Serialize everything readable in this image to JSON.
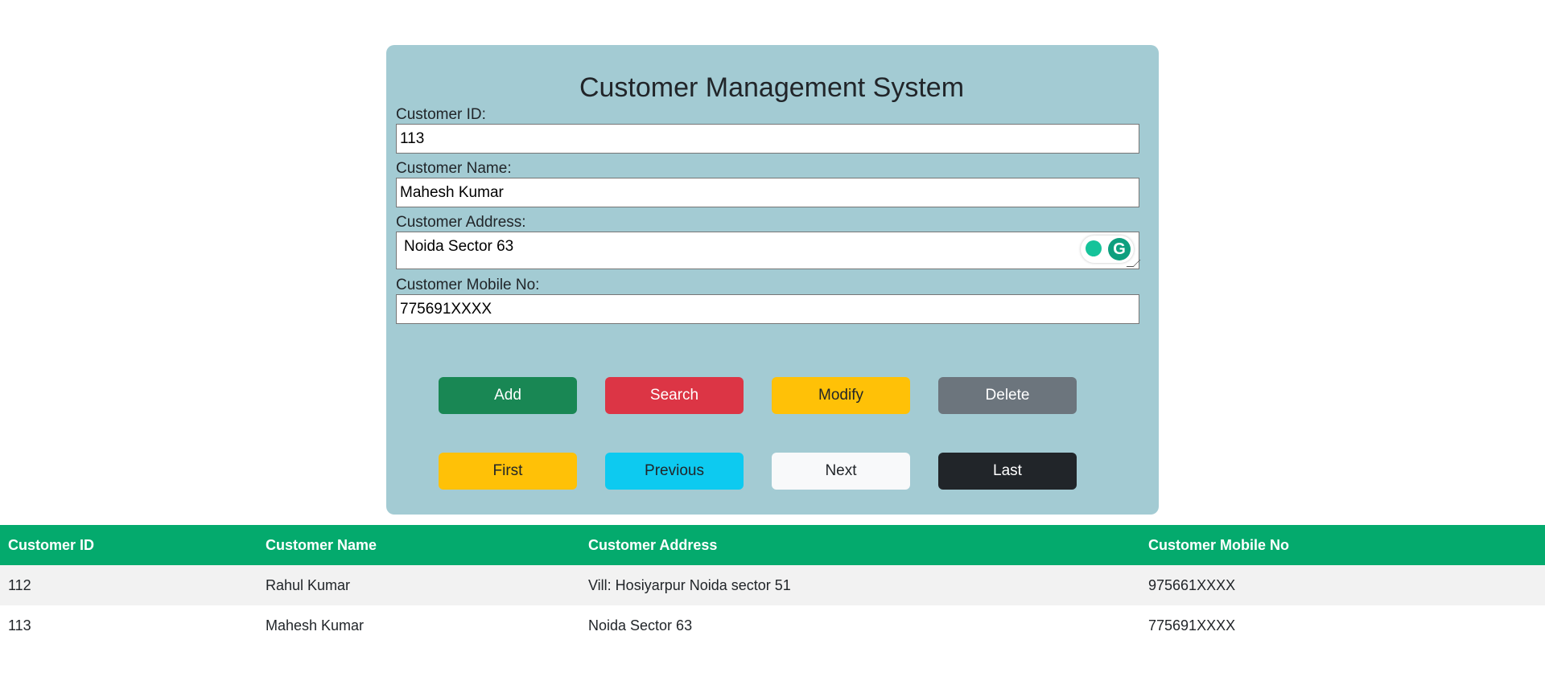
{
  "app": {
    "title": "Customer Management System"
  },
  "form": {
    "id_label": "Customer ID:",
    "id_value": "113",
    "name_label": "Customer Name:",
    "name_value": "Mahesh Kumar",
    "address_label": "Customer Address:",
    "address_value": "Noida Sector 63",
    "mobile_label": "Customer Mobile No:",
    "mobile_value": "775691XXXX"
  },
  "actions": {
    "add": {
      "label": "Add",
      "bg": "#198754",
      "fg": "#ffffff"
    },
    "search": {
      "label": "Search",
      "bg": "#dc3545",
      "fg": "#ffffff"
    },
    "modify": {
      "label": "Modify",
      "bg": "#ffc107",
      "fg": "#212529"
    },
    "delete": {
      "label": "Delete",
      "bg": "#6c757d",
      "fg": "#ffffff"
    }
  },
  "navigation": {
    "first": {
      "label": "First",
      "bg": "#ffc107",
      "fg": "#212529"
    },
    "previous": {
      "label": "Previous",
      "bg": "#0dcaf0",
      "fg": "#212529"
    },
    "next": {
      "label": "Next",
      "bg": "#f8f9fa",
      "fg": "#212529"
    },
    "last": {
      "label": "Last",
      "bg": "#212529",
      "fg": "#ffffff"
    }
  },
  "table": {
    "headers": [
      "Customer ID",
      "Customer Name",
      "Customer Address",
      "Customer Mobile No"
    ],
    "rows": [
      [
        "112",
        "Rahul Kumar",
        "Vill: Hosiyarpur Noida sector 51",
        "975661XXXX"
      ],
      [
        "113",
        "Mahesh Kumar",
        "Noida Sector 63",
        "775691XXXX"
      ]
    ]
  },
  "colors": {
    "panel_bg": "#a3cbd3",
    "table_header_bg": "#04aa6d",
    "grammarly": "#15c39a"
  },
  "icons": {
    "grammarly_suggestion": "lightbulb-icon",
    "grammarly_logo": "grammarly-g-icon",
    "resize_handle": "resize-grip-icon"
  }
}
